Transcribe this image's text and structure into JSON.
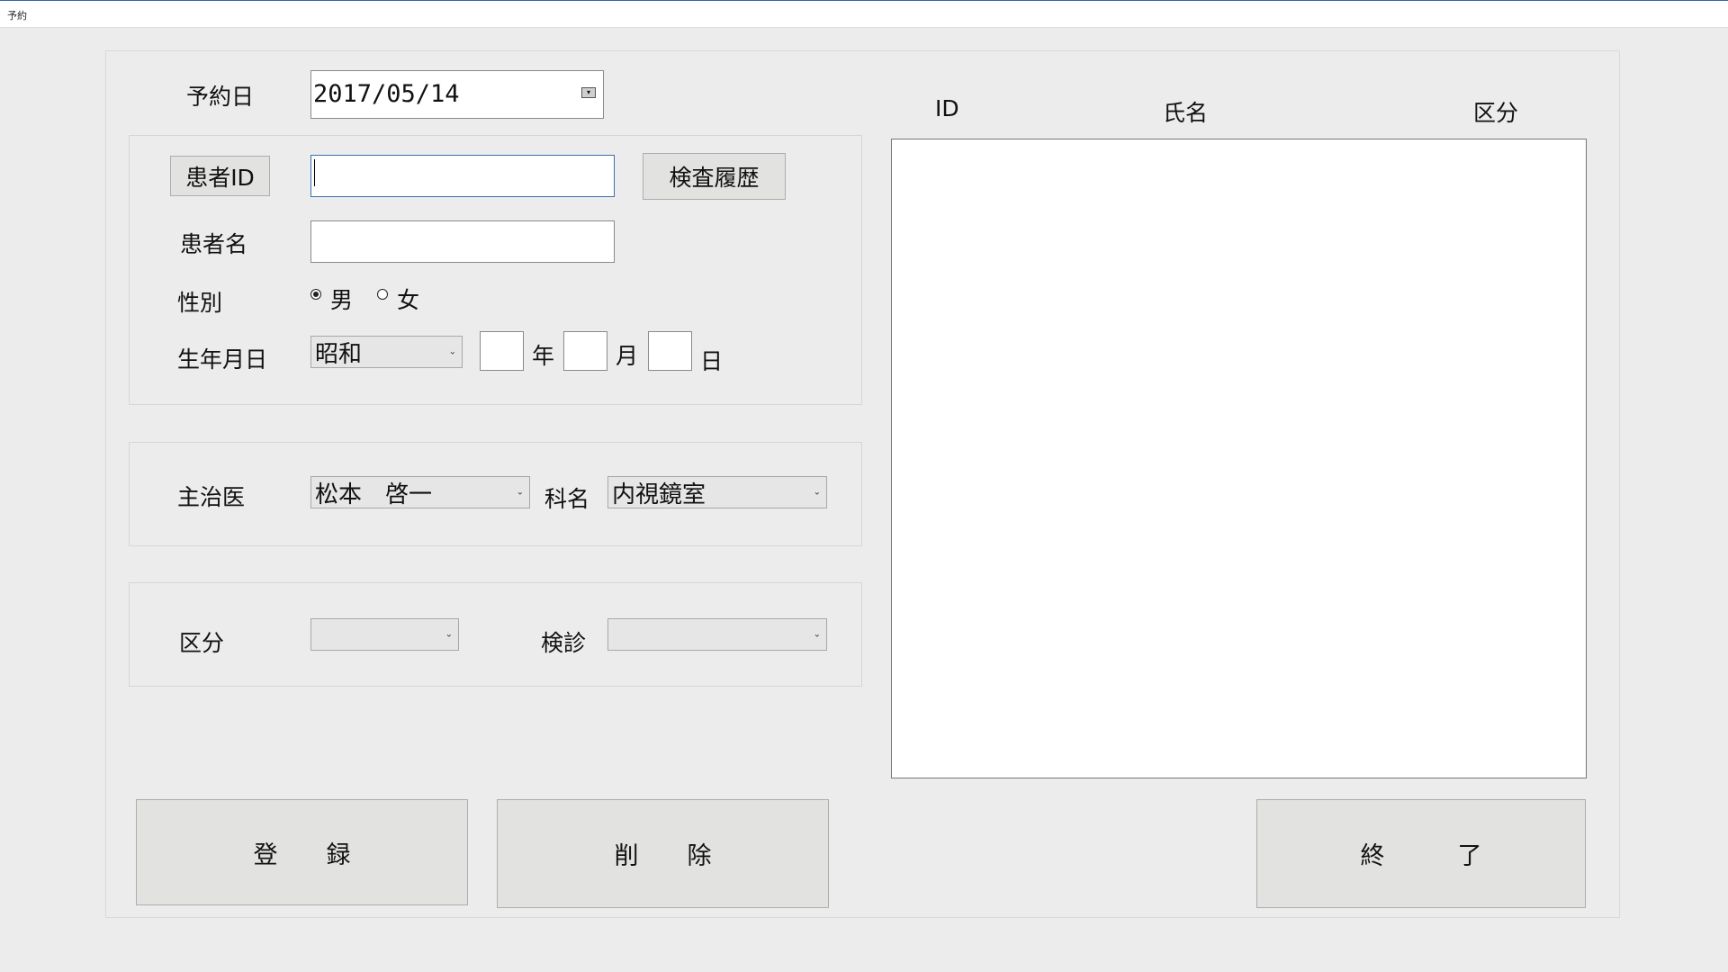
{
  "window": {
    "title": "予約"
  },
  "reservation": {
    "date_label": "予約日",
    "date_value": "2017/05/14"
  },
  "patient": {
    "id_button": "患者ID",
    "id_value": "",
    "history_button": "検査履歴",
    "name_label": "患者名",
    "name_value": "",
    "sex_label": "性別",
    "sex_options": [
      "男",
      "女"
    ],
    "sex_selected": "男",
    "birth_label": "生年月日",
    "era_value": "昭和",
    "year_unit": "年",
    "month_unit": "月",
    "day_unit": "日"
  },
  "doctor": {
    "label": "主治医",
    "value": "松本　啓一",
    "dept_label": "科名",
    "dept_value": "内視鏡室"
  },
  "category": {
    "label": "区分",
    "value": "",
    "exam_label": "検診",
    "exam_value": ""
  },
  "list": {
    "columns": [
      "ID",
      "氏名",
      "区分"
    ],
    "rows": []
  },
  "buttons": {
    "register": "登　　録",
    "delete": "削　　除",
    "exit": "終　　　了"
  },
  "icons": {
    "dropdown": "chevron-down-icon",
    "calendar": "calendar-icon",
    "radio": "radio-icon"
  }
}
